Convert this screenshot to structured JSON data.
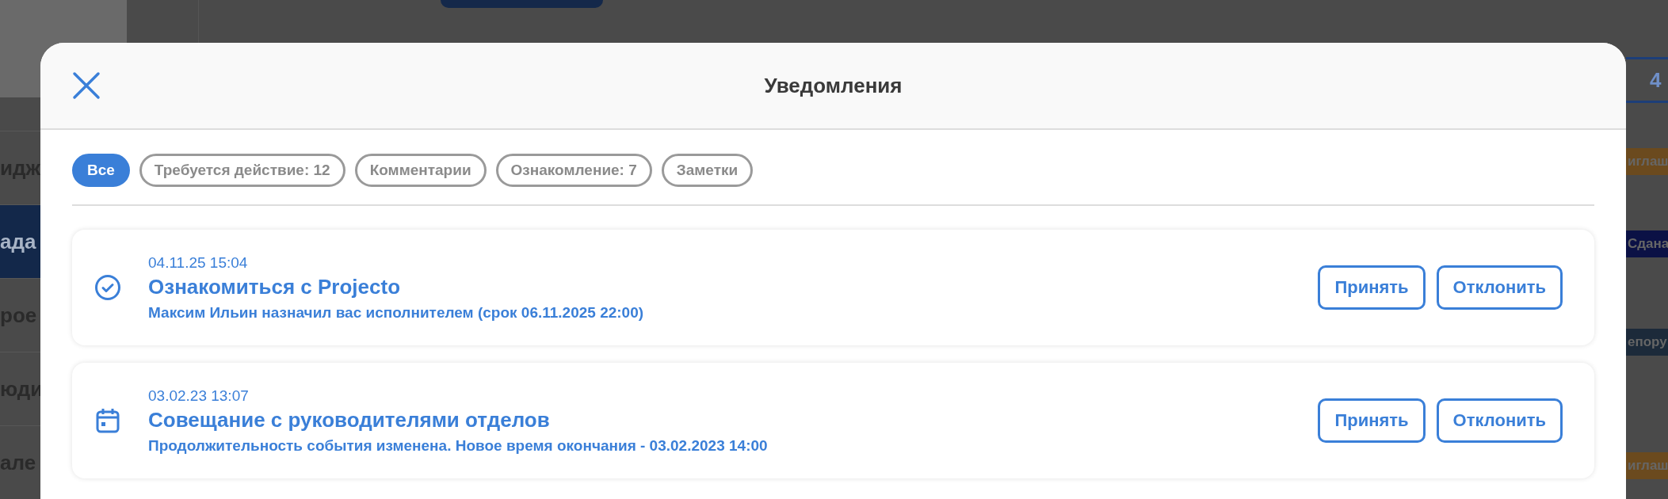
{
  "background": {
    "sidebar": [
      {
        "label": "идж",
        "selected": false
      },
      {
        "label": "ада",
        "selected": true
      },
      {
        "label": "рое",
        "selected": false
      },
      {
        "label": "юди",
        "selected": false
      },
      {
        "label": "але",
        "selected": false
      }
    ],
    "right_tab": "4",
    "badges": [
      {
        "label": "иглаш",
        "color": "#6b4a1e"
      },
      {
        "label": "Сдана",
        "color": "#0b1145"
      },
      {
        "label": "епору",
        "color": "#1c2a3a"
      },
      {
        "label": "иглаш",
        "color": "#6b4a1e"
      }
    ]
  },
  "modal": {
    "title": "Уведомления",
    "filters": [
      {
        "label": "Все",
        "selected": true
      },
      {
        "label": "Требуется действие: 12",
        "selected": false
      },
      {
        "label": "Комментарии",
        "selected": false
      },
      {
        "label": "Ознакомление: 7",
        "selected": false
      },
      {
        "label": "Заметки",
        "selected": false
      }
    ],
    "notifications": [
      {
        "kind": "task",
        "time": "04.11.25 15:04",
        "title": "Ознакомиться с Projecto",
        "text": "Максим Ильин назначил вас исполнителем (срок 06.11.2025 22:00)",
        "actions": [
          "Принять",
          "Отклонить"
        ]
      },
      {
        "kind": "event",
        "time": "03.02.23 13:07",
        "title": "Совещание с руководителями отделов",
        "text": "Продолжительность события изменена. Новое время окончания - 03.02.2023 14:00",
        "actions": [
          "Принять",
          "Отклонить"
        ]
      }
    ]
  }
}
